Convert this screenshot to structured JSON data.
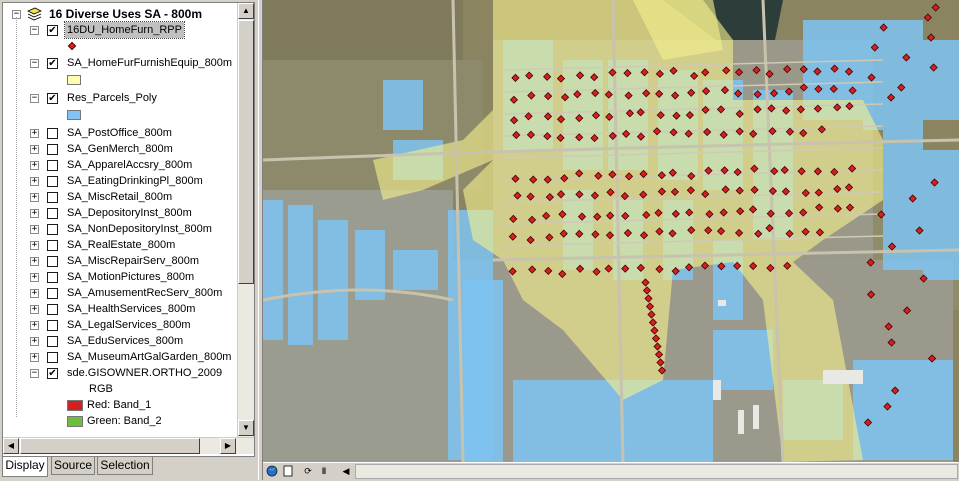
{
  "toc": {
    "group_title": "16 Diverse Uses SA - 800m",
    "layers": [
      {
        "name": "16DU_HomeFurn_RPP",
        "checked": true,
        "expanded": true,
        "selected": true,
        "symbol": "red-diamond"
      },
      {
        "name": "SA_HomeFurFurnishEquip_800m",
        "checked": true,
        "expanded": true,
        "symbol": "yellow-fill",
        "color": "#fffbb0"
      },
      {
        "name": "Res_Parcels_Poly",
        "checked": true,
        "expanded": true,
        "symbol": "blue-fill",
        "color": "#7ec3f2"
      },
      {
        "name": "SA_PostOffice_800m",
        "checked": false,
        "expanded": false
      },
      {
        "name": "SA_GenMerch_800m",
        "checked": false,
        "expanded": false
      },
      {
        "name": "SA_ApparelAccsry_800m",
        "checked": false,
        "expanded": false
      },
      {
        "name": "SA_EatingDrinkingPl_800m",
        "checked": false,
        "expanded": false
      },
      {
        "name": "SA_MiscRetail_800m",
        "checked": false,
        "expanded": false
      },
      {
        "name": "SA_DepositoryInst_800m",
        "checked": false,
        "expanded": false
      },
      {
        "name": "SA_NonDepositoryInst_800m",
        "checked": false,
        "expanded": false
      },
      {
        "name": "SA_RealEstate_800m",
        "checked": false,
        "expanded": false
      },
      {
        "name": "SA_MiscRepairServ_800m",
        "checked": false,
        "expanded": false
      },
      {
        "name": "SA_MotionPictures_800m",
        "checked": false,
        "expanded": false
      },
      {
        "name": "SA_AmusementRecServ_800m",
        "checked": false,
        "expanded": false
      },
      {
        "name": "SA_HealthServices_800m",
        "checked": false,
        "expanded": false
      },
      {
        "name": "SA_LegalServices_800m",
        "checked": false,
        "expanded": false
      },
      {
        "name": "SA_EduServices_800m",
        "checked": false,
        "expanded": false
      },
      {
        "name": "SA_MuseumArtGalGarden_800m",
        "checked": false,
        "expanded": false
      },
      {
        "name": "sde.GISOWNER.ORTHO_2009",
        "checked": true,
        "expanded": true
      }
    ],
    "raster_legend": {
      "rgb_label": "RGB",
      "bands": [
        {
          "label": "Red:  Band_1",
          "color": "#d02020"
        },
        {
          "label": "Green: Band_2",
          "color": "#6cbf3c"
        }
      ]
    },
    "tabs": [
      "Display",
      "Source",
      "Selection"
    ],
    "active_tab": "Display"
  },
  "map": {
    "description_colors": {
      "parcels": "#7ec3f2",
      "service_area": "#f4ef8c",
      "points": "#d42020"
    }
  },
  "map_toolbar": {
    "icons": [
      "globe-icon",
      "page-layout-icon",
      "refresh-icon",
      "pause-icon",
      "scroll-left-icon"
    ]
  }
}
